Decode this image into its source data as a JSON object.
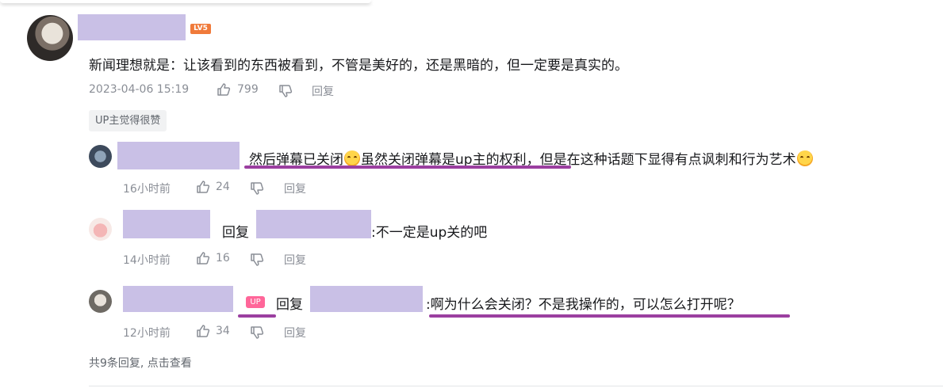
{
  "main_comment": {
    "level": "LV5",
    "text": "新闻理想就是：让该看到的东西被看到，不管是美好的，还是黑暗的，但一定要是真实的。",
    "date": "2023-04-06 15:19",
    "likes": "799",
    "reply_label": "回复",
    "tag": "UP主觉得很赞"
  },
  "replies": [
    {
      "text_a": "然后弹幕已关闭",
      "text_b": "虽然关闭弹幕是up主的权利",
      "text_c": "，但是在这种话题下显得有点讽刺和行为艺术",
      "time": "16小时前",
      "likes": "24",
      "reply_label": "回复"
    },
    {
      "reply_word": "回复",
      "text": ":不一定是up关的吧",
      "time": "14小时前",
      "likes": "16",
      "reply_label": "回复"
    },
    {
      "up_badge": "UP",
      "reply_word": "回复",
      "text": ":啊为什么会关闭？不是我操作的，可以怎么打开呢？",
      "time": "12小时前",
      "likes": "34",
      "reply_label": "回复"
    }
  ],
  "more_replies": "共9条回复, 点击查看",
  "colors": {
    "redaction": "#c9c0e6",
    "underline": "#9b3fa0",
    "level_badge": "#f07a3a",
    "up_badge": "#ff6699"
  },
  "icons": [
    "thumbs-up-icon",
    "thumbs-down-icon",
    "laughing-emoji-icon"
  ]
}
